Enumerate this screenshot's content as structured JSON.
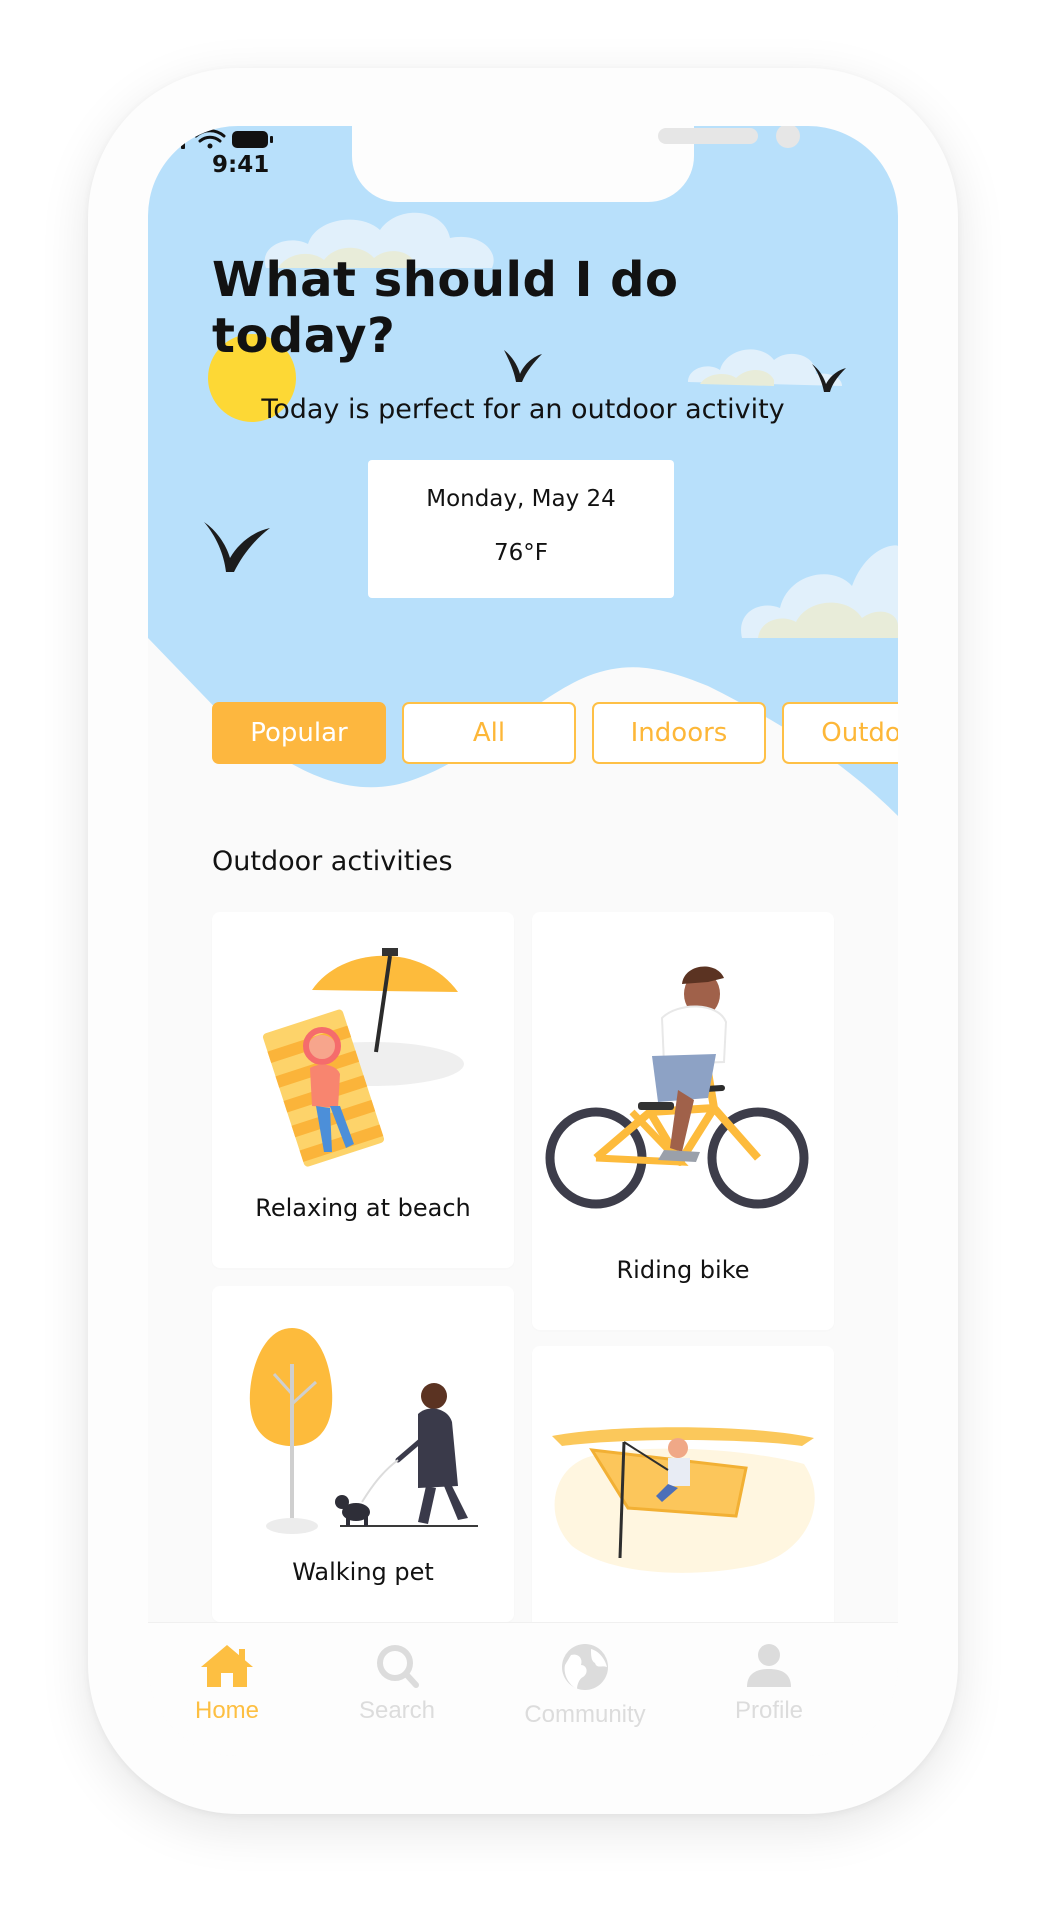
{
  "status_bar": {
    "time": "9:41",
    "icons": [
      "signal-icon",
      "wifi-icon",
      "battery-icon"
    ]
  },
  "hero": {
    "title": "What should I do today?",
    "subtitle": "Today is perfect for an outdoor activity",
    "weather": {
      "date": "Monday, May 24",
      "temperature": "76°F"
    }
  },
  "filters": [
    {
      "label": "Popular",
      "active": true
    },
    {
      "label": "All",
      "active": false
    },
    {
      "label": "Indoors",
      "active": false
    },
    {
      "label": "Outdoo",
      "active": false
    }
  ],
  "section": {
    "title": "Outdoor activities"
  },
  "activities": [
    {
      "label": "Relaxing at beach",
      "illustration": "beach-illustration"
    },
    {
      "label": "Riding bike",
      "illustration": "bike-illustration"
    },
    {
      "label": "Walking pet",
      "illustration": "walking-pet-illustration"
    },
    {
      "label": "",
      "illustration": "fishing-boat-illustration"
    }
  ],
  "bottom_nav": [
    {
      "label": "Home",
      "icon": "home-icon",
      "active": true
    },
    {
      "label": "Search",
      "icon": "search-icon",
      "active": false
    },
    {
      "label": "Community",
      "icon": "globe-icon",
      "active": false
    },
    {
      "label": "Profile",
      "icon": "profile-icon",
      "active": false
    }
  ],
  "colors": {
    "sky": "#b8e0fb",
    "accent": "#fdb73f",
    "sun": "#fdd835",
    "background": "#fafafa",
    "nav_inactive": "#dcdcdc"
  }
}
